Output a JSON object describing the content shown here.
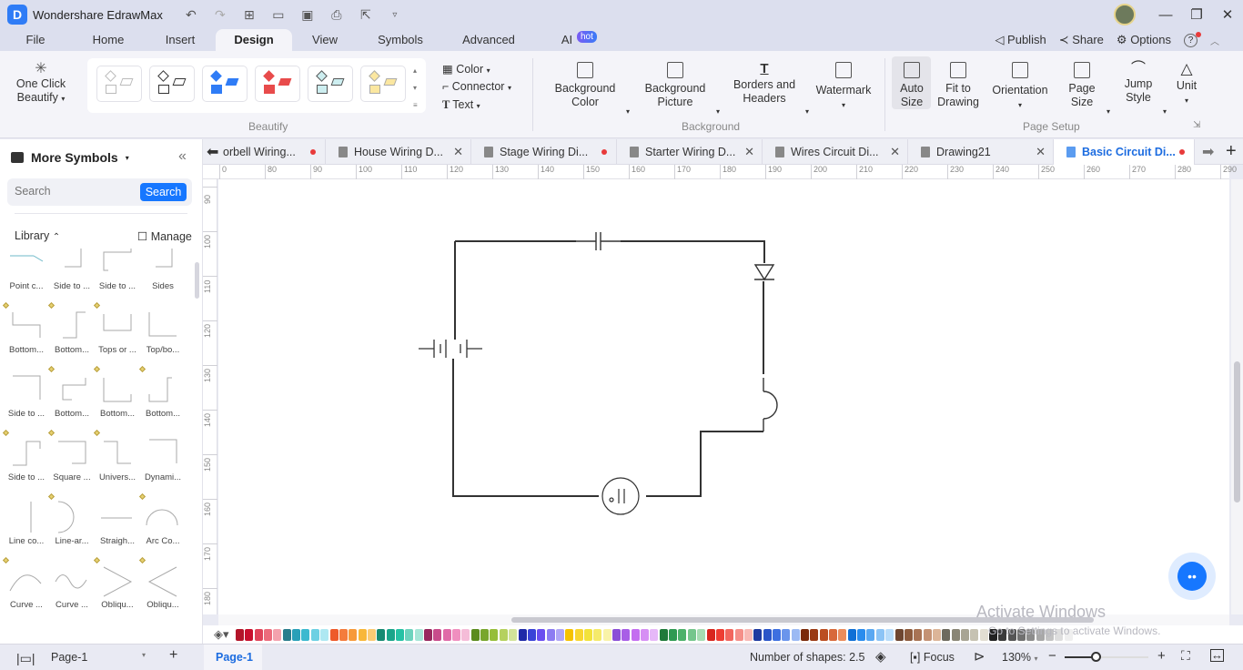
{
  "app": {
    "title": "Wondershare EdrawMax",
    "logo_glyph": "D",
    "quick_access": [
      "undo-icon",
      "redo-icon",
      "new-icon",
      "open-icon",
      "save-icon",
      "print-icon",
      "export-icon",
      "more-icon"
    ]
  },
  "window_controls": {
    "minimize": "—",
    "restore": "❐",
    "close": "✕"
  },
  "menu": {
    "tabs": [
      "File",
      "Home",
      "Insert",
      "Design",
      "View",
      "Symbols",
      "Advanced",
      "AI"
    ],
    "active": "Design",
    "ai_badge": "hot",
    "right": {
      "publish": "Publish",
      "share": "Share",
      "options": "Options",
      "help": "?"
    }
  },
  "ribbon": {
    "one_click": "One Click\nBeautify",
    "beautify_group": "Beautify",
    "small_cmds": [
      "Color",
      "Connector",
      "Text"
    ],
    "background_buttons": [
      {
        "line1": "Background",
        "line2": "Color"
      },
      {
        "line1": "Background",
        "line2": "Picture"
      },
      {
        "line1": "Borders and",
        "line2": "Headers"
      },
      {
        "line1": "Watermark",
        "line2": ""
      }
    ],
    "background_group": "Background",
    "page_setup_buttons": [
      {
        "line1": "Auto",
        "line2": "Size"
      },
      {
        "line1": "Fit to",
        "line2": "Drawing"
      },
      {
        "line1": "Orientation",
        "line2": ""
      },
      {
        "line1": "Page",
        "line2": "Size"
      },
      {
        "line1": "Jump",
        "line2": "Style"
      },
      {
        "line1": "Unit",
        "line2": ""
      }
    ],
    "page_setup_group": "Page Setup"
  },
  "left_panel": {
    "title": "More Symbols",
    "search_placeholder": "Search",
    "search_button": "Search",
    "library_label": "Library",
    "manage_label": "Manage",
    "symbols": [
      "Point c...",
      "Side to ...",
      "Side to ...",
      "Sides",
      "Bottom...",
      "Bottom...",
      "Tops or ...",
      "Top/bo...",
      "Side to ...",
      "Bottom...",
      "Bottom...",
      "Bottom...",
      "Side to ...",
      "Square ...",
      "Univers...",
      "Dynami...",
      "Line co...",
      "Line-ar...",
      "Straigh...",
      "Arc Co...",
      "Curve ...",
      "Curve ...",
      "Obliqu...",
      "Obliqu..."
    ]
  },
  "doc_tabs": [
    {
      "label": "orbell Wiring...",
      "state": "unsaved"
    },
    {
      "label": "House Wiring D...",
      "state": "close"
    },
    {
      "label": "Stage Wiring Di...",
      "state": "unsaved"
    },
    {
      "label": "Starter Wiring D...",
      "state": "close"
    },
    {
      "label": "Wires Circuit Di...",
      "state": "close"
    },
    {
      "label": "Drawing21",
      "state": "close"
    },
    {
      "label": "Basic Circuit Di...",
      "state": "unsaved",
      "active": true
    }
  ],
  "rulers": {
    "horizontal": [
      "0",
      "80",
      "90",
      "100",
      "110",
      "120",
      "130",
      "140",
      "150",
      "160",
      "170",
      "180",
      "190",
      "200",
      "210",
      "220",
      "230",
      "240",
      "250",
      "260",
      "270",
      "280",
      "290"
    ],
    "vertical": [
      "90",
      "100",
      "110",
      "120",
      "130",
      "140",
      "150",
      "160",
      "170",
      "180"
    ]
  },
  "diagram": {
    "type": "basic circuit",
    "components": [
      "capacitor",
      "diode",
      "battery",
      "lamp-arc",
      "ac-source"
    ]
  },
  "palette": {
    "colors": [
      "#b3152a",
      "#c8102e",
      "#e0445a",
      "#ec6c7c",
      "#f4a2ad",
      "#2a7d8c",
      "#2aa0b8",
      "#3cb9cf",
      "#6dd0e3",
      "#aee8f2",
      "#ee5a2a",
      "#f47c3c",
      "#f79a3a",
      "#f8b739",
      "#fbcb74",
      "#168a72",
      "#1aa58a",
      "#26c2a4",
      "#6dd3bd",
      "#a6e6d7",
      "#98285e",
      "#c84b8b",
      "#e06ba8",
      "#f08fbf",
      "#f5bcd8",
      "#5b8c1e",
      "#78a62d",
      "#96be3a",
      "#b5d15e",
      "#d2e39a",
      "#1f2aa8",
      "#3a43d8",
      "#6a4df0",
      "#8c7cf2",
      "#b0a6f6",
      "#f6c200",
      "#f8d630",
      "#f2e23b",
      "#f5ea6a",
      "#f9f3a8",
      "#8b4fd6",
      "#a85ee6",
      "#c46ef0",
      "#d68ff4",
      "#e6b8f8",
      "#1f7a3a",
      "#2f9a52",
      "#4cb16a",
      "#75c68c",
      "#a6dcb2",
      "#d8261e",
      "#ee3d33",
      "#f2665e",
      "#f58f89",
      "#f8b9b5",
      "#1e3aa0",
      "#2a55c8",
      "#3d6fe0",
      "#6a95ec",
      "#9cbaf4",
      "#7a2a0a",
      "#9a3a14",
      "#bb4e22",
      "#d8693a",
      "#ea8c5c",
      "#0f6fd6",
      "#2a8cee",
      "#5aa8f2",
      "#8cc4f6",
      "#b8dcfa",
      "#6e4630",
      "#8c5a3c",
      "#a87354",
      "#c49274",
      "#dcb598",
      "#6e6a5e",
      "#8a8676",
      "#a8a494",
      "#c6c2b2",
      "#e2ded2",
      "#222222",
      "#3a3a3a",
      "#555555",
      "#707070",
      "#8c8c8c",
      "#a8a8a8",
      "#c4c4c4",
      "#dedede",
      "#efefef"
    ]
  },
  "status": {
    "page_selector": "Page-1",
    "page_tab": "Page-1",
    "shape_count": "Number of shapes: 2.5",
    "focus": "Focus",
    "zoom": "130%",
    "zoom_fraction": 0.38
  },
  "watermark": {
    "line1": "Activate Windows",
    "line2": "Go to Settings to activate Windows."
  }
}
